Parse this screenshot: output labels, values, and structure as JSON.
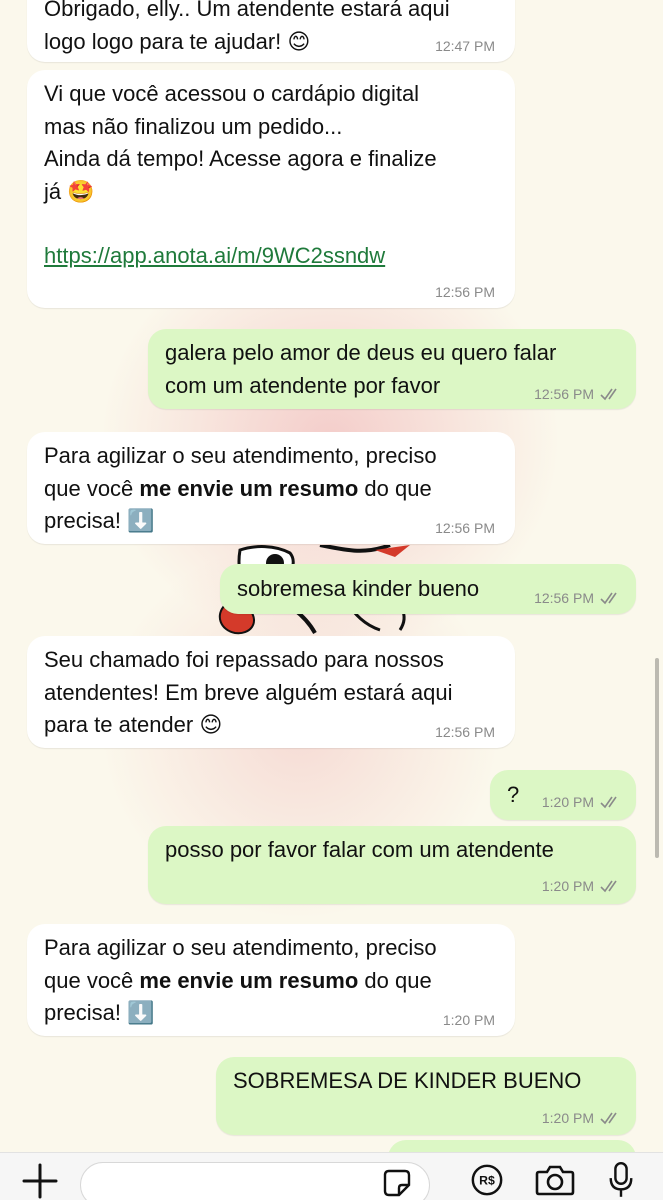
{
  "messages": [
    {
      "dir": "in",
      "lines": [
        "Obrigado, elly.. Um atendente estará aqui",
        "logo logo para te ajudar! 😊"
      ],
      "time": "12:47 PM"
    },
    {
      "dir": "in",
      "lines": [
        "Vi que você acessou o cardápio digital",
        "mas não finalizou um pedido...",
        "Ainda dá tempo! Acesse agora e finalize",
        "já 🤩"
      ],
      "link": "https://app.anota.ai/m/9WC2ssndw",
      "time": "12:56 PM"
    },
    {
      "dir": "out",
      "lines": [
        "galera pelo amor de deus eu quero falar",
        "com um atendente por favor"
      ],
      "time": "12:56 PM"
    },
    {
      "dir": "in",
      "lines": [
        "Para agilizar o seu atendimento, preciso",
        "que você ",
        "me envie um resumo",
        " do que",
        "precisa! ⬇️"
      ],
      "time": "12:56 PM"
    },
    {
      "dir": "out",
      "lines": [
        "sobremesa kinder bueno"
      ],
      "time": "12:56 PM"
    },
    {
      "dir": "in",
      "lines": [
        "Seu chamado foi repassado para nossos",
        "atendentes! Em breve alguém estará aqui",
        "para te atender 😊"
      ],
      "time": "12:56 PM"
    },
    {
      "dir": "out",
      "lines": [
        "?"
      ],
      "time": "1:20 PM"
    },
    {
      "dir": "out",
      "lines": [
        "posso por favor falar com um atendente"
      ],
      "time": "1:20 PM"
    },
    {
      "dir": "in",
      "lines": [
        "Para agilizar o seu atendimento, preciso",
        "que você ",
        "me envie um resumo",
        " do que",
        "precisa! ⬇️"
      ],
      "time": "1:20 PM"
    },
    {
      "dir": "out",
      "lines": [
        "SOBREMESA DE KINDER BUENO"
      ],
      "time": "1:20 PM"
    }
  ],
  "composer": {
    "icons": [
      "plus-icon",
      "sticker-icon",
      "pix-payment-icon",
      "camera-icon",
      "microphone-icon"
    ]
  },
  "colors": {
    "incoming": "#ffffff",
    "outgoing": "#dcf7c5",
    "background": "#fbf8ec",
    "link": "#1f7a3b"
  }
}
